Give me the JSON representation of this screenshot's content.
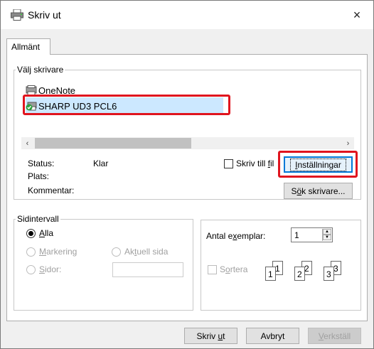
{
  "window": {
    "title": "Skriv ut",
    "close_glyph": "×",
    "icons": {
      "title": "printer-icon",
      "close": "close-icon"
    }
  },
  "tabs": [
    {
      "label": "Allmänt"
    }
  ],
  "select_printer": {
    "legend": "Välj skrivare",
    "printers": [
      {
        "name": "OneNote",
        "icon": "onenote-printer-icon",
        "selected": false
      },
      {
        "name": "SHARP UD3 PCL6",
        "icon": "default-printer-icon",
        "selected": true
      }
    ],
    "scroll_left": "‹",
    "scroll_right": "›",
    "status_label": "Status:",
    "status_value": "Klar",
    "location_label": "Plats:",
    "location_value": "",
    "comment_label": "Kommentar:",
    "comment_value": "",
    "print_to_file": {
      "label_prefix": "Skriv till ",
      "label_accel": "f",
      "label_suffix": "il",
      "checked": false
    },
    "preferences_button": {
      "accel": "I",
      "rest": "nställningar"
    },
    "find_printer_button": {
      "prefix": "S",
      "accel": "ö",
      "rest": "k skrivare..."
    }
  },
  "page_range": {
    "legend": "Sidintervall",
    "all": {
      "accel": "A",
      "rest": "lla",
      "checked": true
    },
    "selection": {
      "accel": "M",
      "rest": "arkering",
      "enabled": false
    },
    "current_page": {
      "prefix": "Ak",
      "accel": "t",
      "rest": "uell sida",
      "enabled": false
    },
    "pages": {
      "accel": "S",
      "rest": "idor:",
      "enabled": false
    },
    "pages_value": ""
  },
  "copies": {
    "label_prefix": "Antal e",
    "label_accel": "x",
    "label_suffix": "emplar:",
    "value": "1",
    "collate": {
      "prefix": "S",
      "accel": "o",
      "rest": "rtera",
      "enabled": false
    },
    "collate_pages": [
      "1",
      "1",
      "2",
      "2",
      "3",
      "3"
    ]
  },
  "footer": {
    "print_button": {
      "prefix": "Skriv ",
      "accel": "u",
      "rest": "t"
    },
    "cancel_button": "Avbryt",
    "apply_button": {
      "accel": "V",
      "rest": "erkställ",
      "enabled": false
    }
  },
  "colors": {
    "highlight": "#e0141e",
    "selection": "#cce8ff",
    "focus": "#0078d7"
  }
}
